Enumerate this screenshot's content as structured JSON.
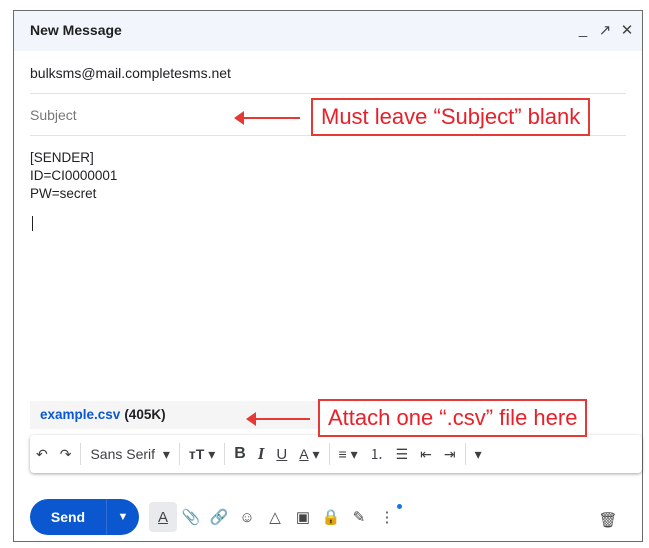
{
  "window": {
    "title": "New Message",
    "controls": {
      "minimize": "_",
      "popout": "↗",
      "close": "✕"
    }
  },
  "compose": {
    "to_value": "bulksms@mail.completesms.net",
    "subject_placeholder": "Subject",
    "body_lines": [
      "[SENDER]",
      "ID=CI0000001",
      "PW=secret"
    ]
  },
  "attachment": {
    "name": "example.csv",
    "size": "(405K)"
  },
  "toolbar": {
    "undo": "↶",
    "redo": "↷",
    "font": "Sans Serif",
    "font_caret": "▾",
    "size": "тT",
    "size_caret": "▾",
    "bold": "B",
    "italic": "I",
    "underline": "U",
    "text_color": "A",
    "text_color_caret": "▾",
    "align": "≡",
    "align_caret": "▾",
    "numbered": "⒈",
    "bulleted": "☰",
    "indent_less": "⇤",
    "indent_more": "⇥",
    "more_caret": "▾"
  },
  "bottom": {
    "send_label": "Send",
    "send_more": "▼",
    "format": "A",
    "attach": "📎",
    "link": "🔗",
    "emoji": "☺",
    "drive": "△",
    "photo": "▣",
    "confidential": "🔒",
    "signature": "✎",
    "more": "⋮",
    "trash": "🗑"
  },
  "annotations": {
    "subject_note": "Must leave “Subject” blank",
    "attach_note": "Attach one “.csv” file here"
  },
  "colors": {
    "accent": "#0b57d0",
    "annotation": "#e53935",
    "titlebar": "#f2f6fc"
  }
}
